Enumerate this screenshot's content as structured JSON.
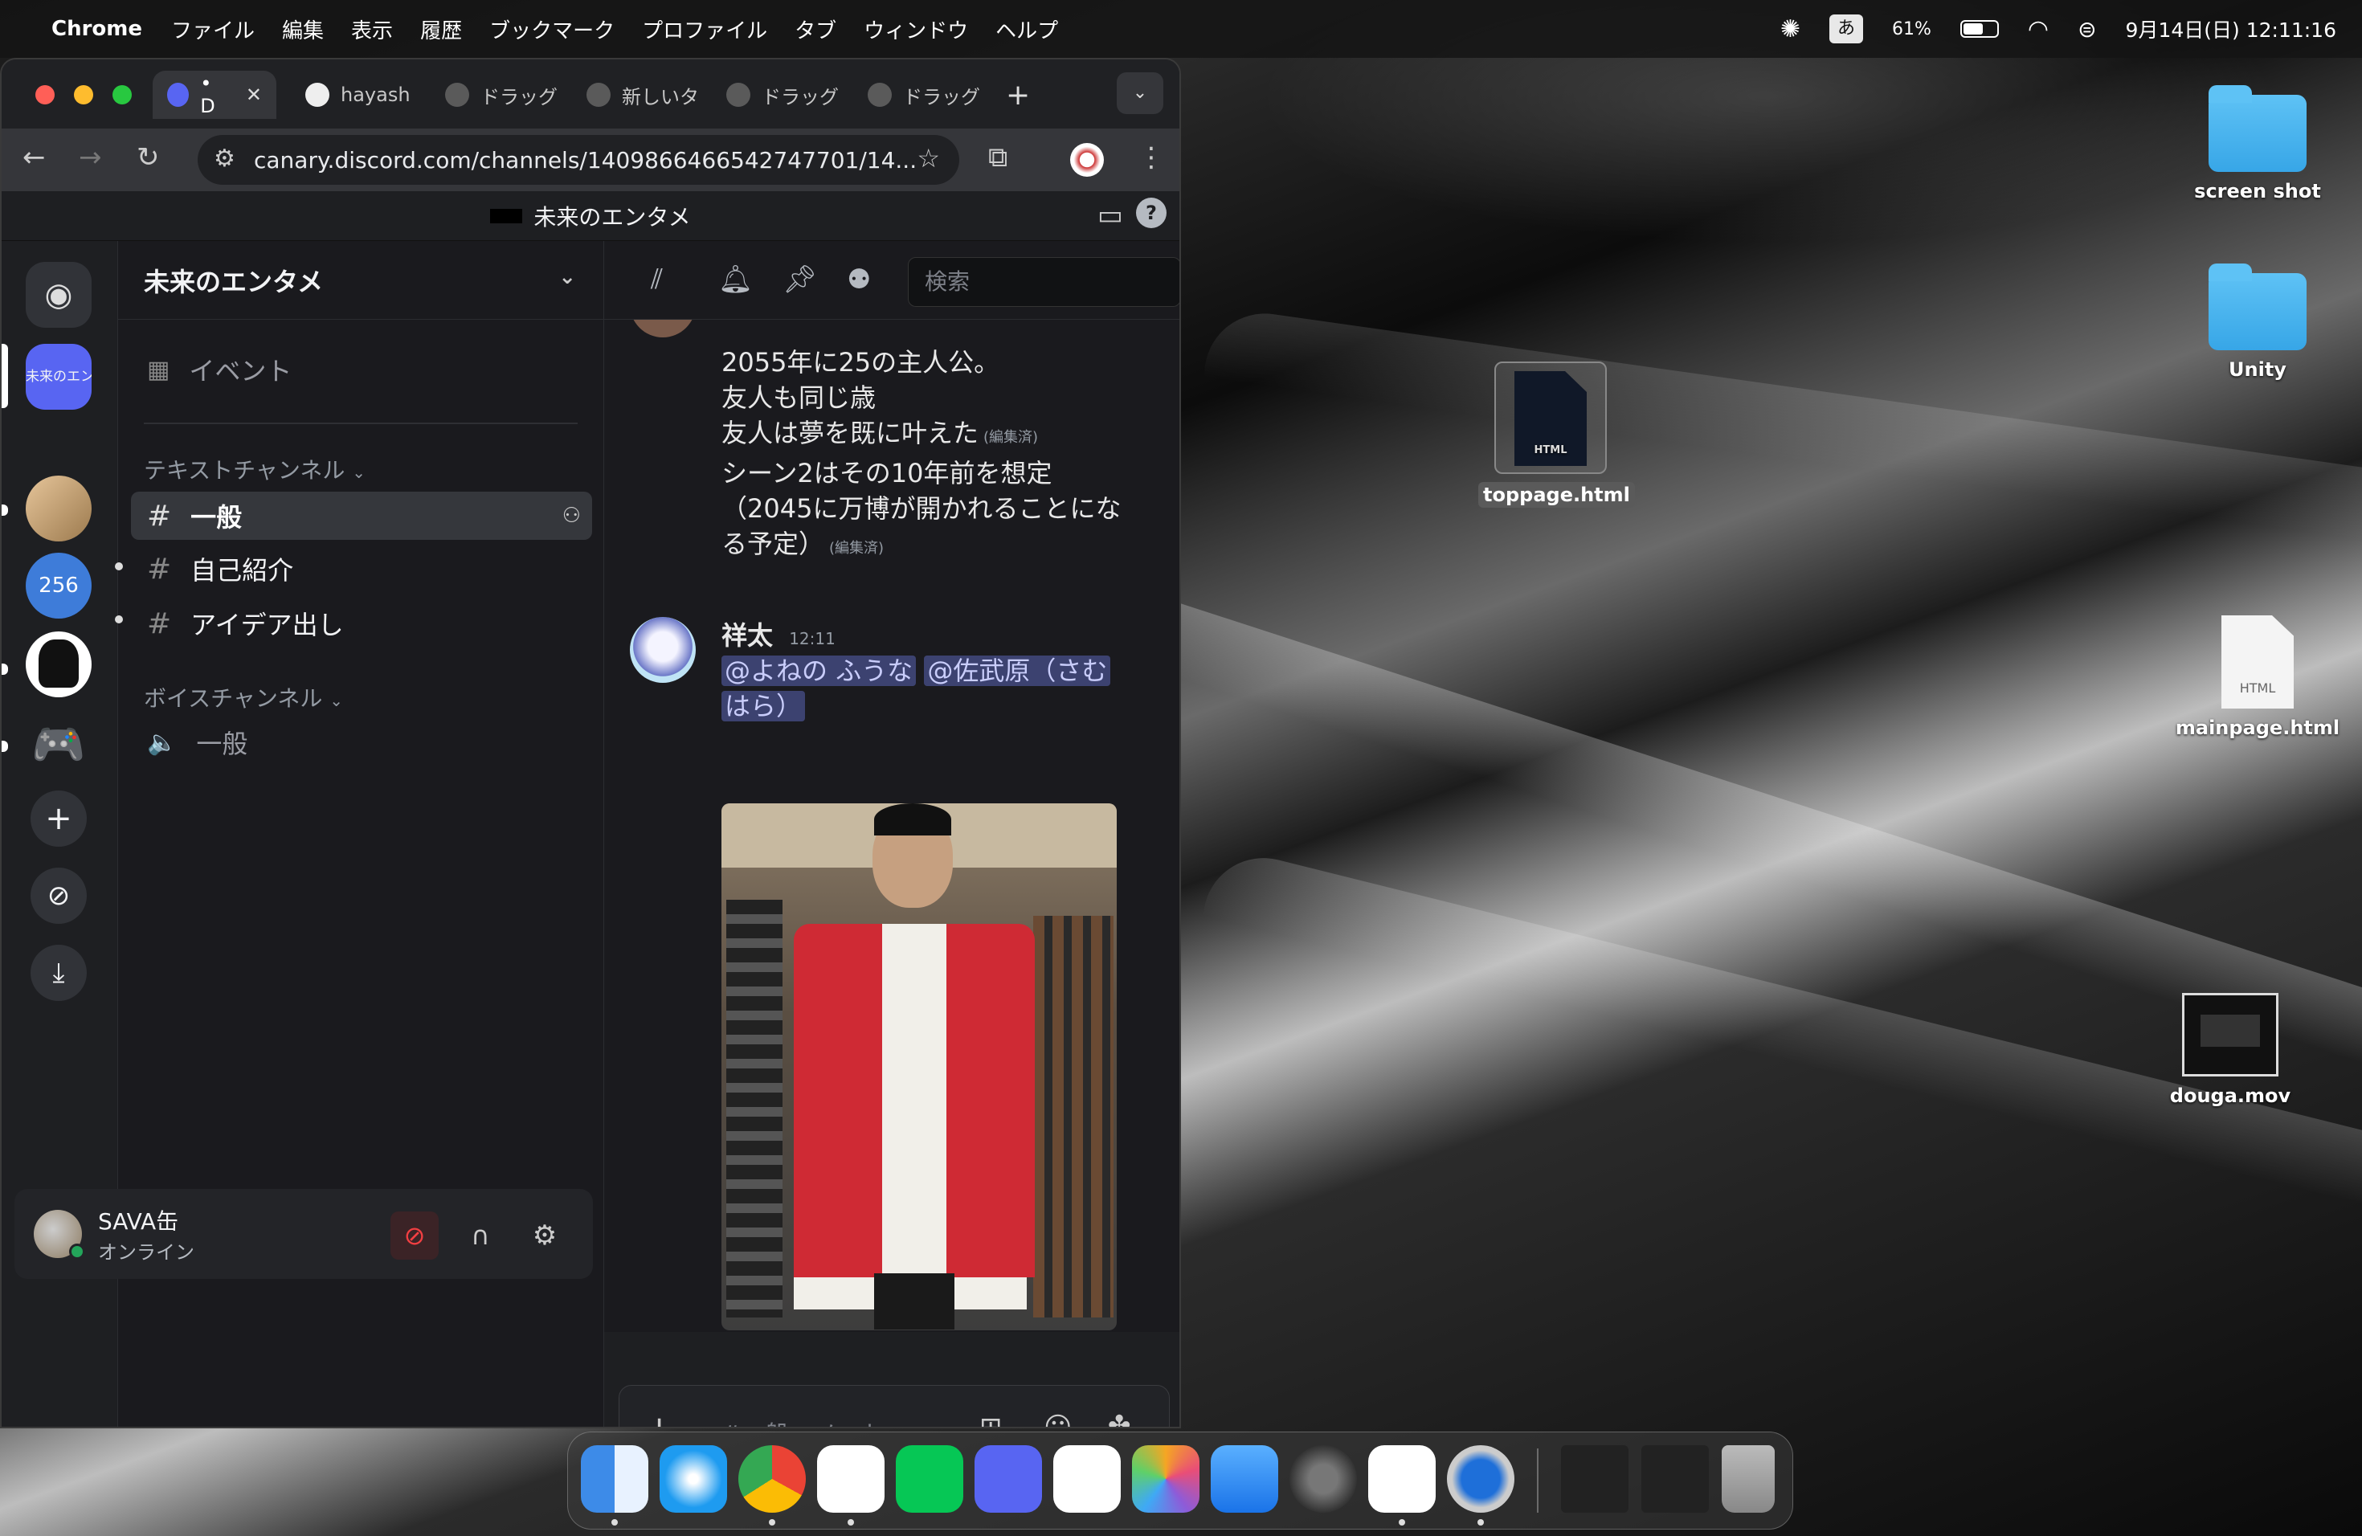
{
  "menubar": {
    "app_name": "Chrome",
    "menus": [
      "ファイル",
      "編集",
      "表示",
      "履歴",
      "ブックマーク",
      "プロファイル",
      "タブ",
      "ウィンドウ",
      "ヘルプ"
    ],
    "ime": "あ",
    "battery_percent": "61%",
    "battery_level": 0.61,
    "datetime": "9月14日(日)  12:11:16"
  },
  "browser": {
    "tabs": [
      {
        "label": "• D",
        "active": true
      },
      {
        "label": "hayash"
      },
      {
        "label": "ドラッグ"
      },
      {
        "label": "新しいタ"
      },
      {
        "label": "ドラッグ"
      },
      {
        "label": "ドラッグ"
      }
    ],
    "url": "canary.discord.com/channels/1409866466542747701/14..."
  },
  "discord": {
    "window_title": "未来のエンタメ",
    "server_name": "未来のエンタメ",
    "guild_active_label": "未来のエンタ",
    "events_label": "イベント",
    "text_category": "テキストチャンネル",
    "voice_category": "ボイスチャンネル",
    "text_channels": [
      "一般",
      "自己紹介",
      "アイデア出し"
    ],
    "voice_channels": [
      "一般"
    ],
    "search_placeholder": "検索",
    "user": {
      "name": "SAVA缶",
      "status": "オンライン"
    },
    "composer_placeholder": "#一般へメッセー…",
    "messages": {
      "top_lines": [
        "2055年に25の主人公。",
        "友人も同じ歳",
        "友人は夢を既に叶えた",
        "シーン2はその10年前を想定",
        "（2045に万博が開かれることにな",
        "る予定）"
      ],
      "edited_label": "(編集済)",
      "author": "祥太",
      "time": "12:11",
      "mention_1": "@よねの ふうな",
      "mention_2": "@佐武原（さむ",
      "mention_2b": "はら）"
    }
  },
  "desktop": {
    "items": [
      "screen shot",
      "Unity",
      "toppage.html",
      "mainpage.html",
      "douga.mov"
    ],
    "html_badge": "HTML"
  },
  "icons": {
    "apple": "apple-logo-icon",
    "wifi": "wifi-icon",
    "chatgpt": "chatgpt-icon",
    "control_center": "control-center-icon"
  },
  "colors": {
    "discord_blurple": "#5865F2",
    "mic_muted": "#f23f42",
    "online": "#23a55a"
  }
}
